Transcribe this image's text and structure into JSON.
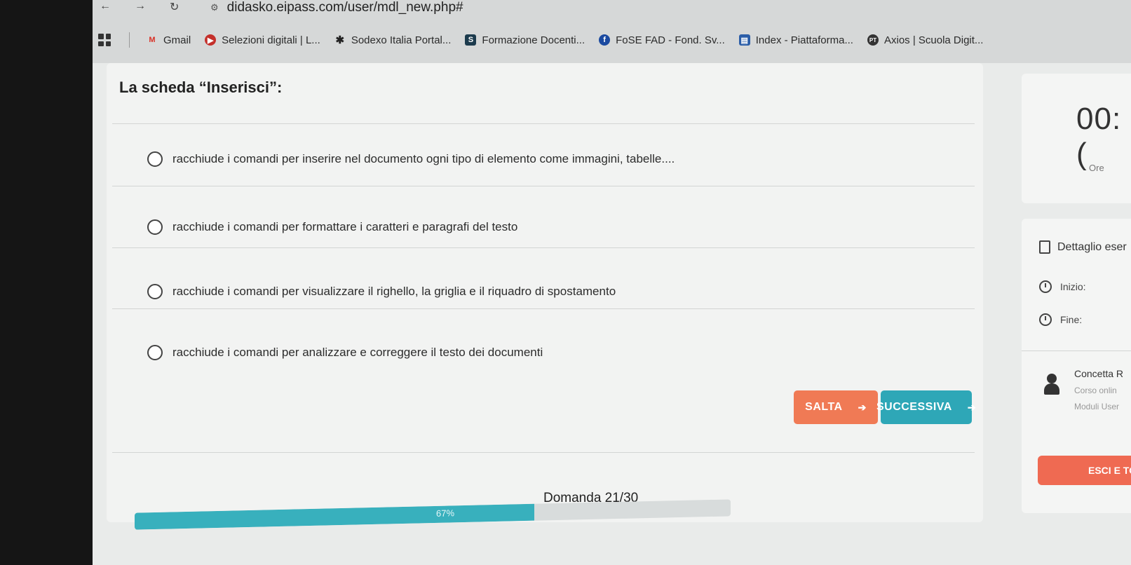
{
  "browser": {
    "url": "didasko.eipass.com/user/mdl_new.php#",
    "bookmarks": [
      {
        "label": "Gmail",
        "icon": "gmail-icon"
      },
      {
        "label": "Selezioni digitali | L...",
        "icon": "youtube-icon"
      },
      {
        "label": "Sodexo Italia Portal...",
        "icon": "star-icon"
      },
      {
        "label": "Formazione Docenti...",
        "icon": "sf-icon"
      },
      {
        "label": "FoSE FAD - Fond. Sv...",
        "icon": "fose-icon"
      },
      {
        "label": "Index - Piattaforma...",
        "icon": "page-icon"
      },
      {
        "label": "Axios | Scuola Digit...",
        "icon": "axios-icon"
      }
    ]
  },
  "quiz": {
    "question_title": "La scheda “Inserisci”:",
    "options": [
      "racchiude i comandi per inserire nel documento ogni tipo di elemento come immagini, tabelle....",
      "racchiude i comandi per formattare i caratteri e paragrafi del testo",
      "racchiude i comandi per visualizzare il righello, la griglia e il riquadro di spostamento",
      "racchiude i comandi per analizzare e correggere il testo dei documenti"
    ],
    "skip_label": "SALTA",
    "next_label": "SUCCESSIVA",
    "question_counter": "Domanda 21/30",
    "progress_label": "67%",
    "progress_fraction": 0.67
  },
  "sidebar": {
    "timer_text": "00:(",
    "timer_unit": "Ore",
    "detail_label": "Dettaglio eser",
    "start_label": "Inizio:",
    "end_label": "Fine:",
    "user_name": "Concetta R",
    "user_course": "Corso onlin",
    "user_module": "Moduli User",
    "exit_label": "ESCI E TO"
  },
  "colors": {
    "skip": "#f07a55",
    "next": "#2ea7b7",
    "progress": "#38b0bd",
    "exit": "#ef6a52"
  }
}
